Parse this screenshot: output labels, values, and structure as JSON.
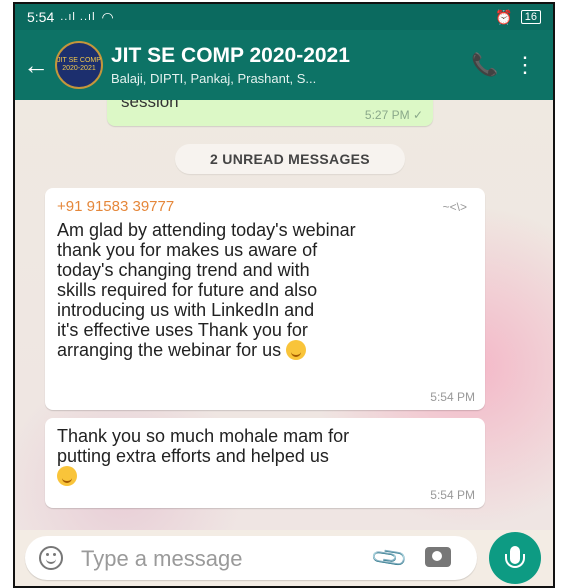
{
  "status_bar": {
    "time": "5:54",
    "signal": "..ıl ..ıl",
    "battery": "16"
  },
  "header": {
    "title": "JIT SE COMP 2020-2021",
    "subtitle": "Balaji, DIPTI, Pankaj, Prashant, S...",
    "avatar_text": "JIT SE COMP 2020-2021",
    "colors": {
      "bar": "#0d7366",
      "status": "#0b6a5f"
    }
  },
  "chat": {
    "previous_message": {
      "text": "session",
      "time": "5:27 PM ✓"
    },
    "unread_banner": "2 UNREAD MESSAGES",
    "messages": [
      {
        "sender": "+91 91583 39777",
        "sender_meta": "~<\\>",
        "lines": [
          "Am glad by attending today's webinar",
          "thank you for makes us aware of",
          "today's changing trend and with",
          "skills required for future and also",
          "introducing us with LinkedIn and",
          "it's effective uses Thank you for",
          "arranging the webinar for us"
        ],
        "time": "5:54 PM"
      },
      {
        "lines": [
          "Thank you so much  mohale mam for",
          "putting extra efforts and helped us"
        ],
        "time": "5:54 PM"
      }
    ]
  },
  "composer": {
    "placeholder": "Type a message",
    "accent": "#0d9b83"
  }
}
